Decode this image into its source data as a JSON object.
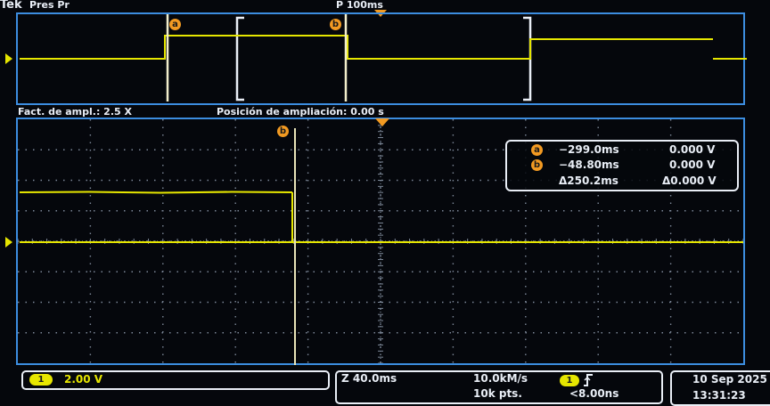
{
  "header": {
    "brand": "Tek",
    "run_status": "Pres Pr",
    "trigger_position": "P 100ms"
  },
  "overview": {
    "cursor_a_label": "a",
    "cursor_b_label": "b"
  },
  "zoom_bar": {
    "zoom_factor": "Fact. de ampl.: 2.5 X",
    "zoom_position": "Posición de ampliación: 0.00 s"
  },
  "zoom_view": {
    "cursor_b_label": "b"
  },
  "cursor_readout": {
    "a_label": "a",
    "a_time": "−299.0ms",
    "a_value": "0.000 V",
    "b_label": "b",
    "b_time": "−48.80ms",
    "b_value": "0.000 V",
    "delta_time": "Δ250.2ms",
    "delta_value": "Δ0.000 V"
  },
  "channel": {
    "marker_label": "1",
    "pill_label": "1",
    "scale": "2.00 V",
    "color": "#e6e600"
  },
  "acquisition": {
    "timebase": "Z 40.0ms",
    "sample_rate": "10.0kM/s",
    "record_length": "10k pts.",
    "trigger_source": "1",
    "trigger_level": "<8.00ns"
  },
  "clock": {
    "date": "10 Sep 2025",
    "time": "13:31:23"
  },
  "colors": {
    "border": "#3c8de0",
    "trace": "#e6e600",
    "cursor_marker": "#f29a22",
    "trigger_marker": "#f29a22"
  }
}
